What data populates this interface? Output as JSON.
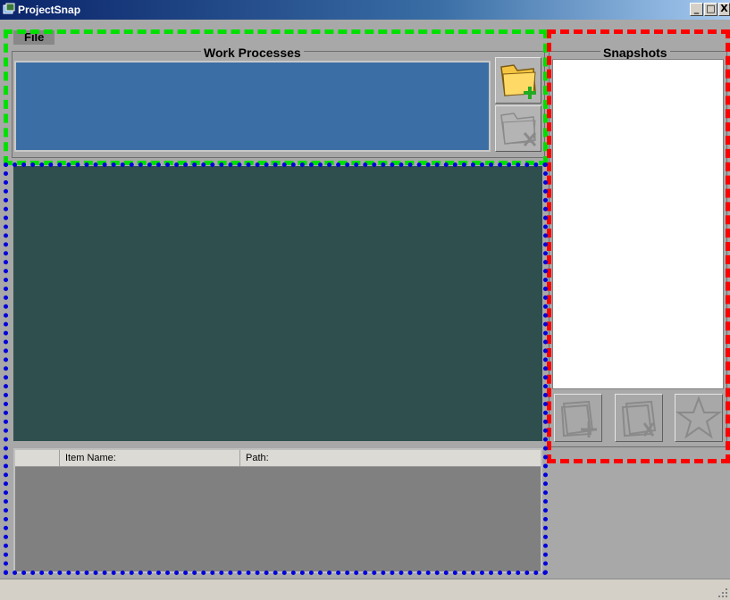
{
  "window": {
    "title": "ProjectSnap",
    "controls": {
      "minimize": "_",
      "maximize": "□",
      "close": "X"
    }
  },
  "menu": {
    "file_label": "File"
  },
  "work_processes": {
    "title": "Work Processes",
    "add_icon": "folder-add-icon",
    "remove_icon": "folder-remove-icon"
  },
  "snapshots": {
    "title": "Snapshots",
    "buttons": [
      {
        "icon": "snapshot-add-icon"
      },
      {
        "icon": "snapshot-remove-icon"
      },
      {
        "icon": "star-icon"
      }
    ]
  },
  "items_table": {
    "columns": [
      "",
      "Item Name:",
      "Path:"
    ]
  },
  "colors": {
    "work_process_list_bg": "#3b6ea5",
    "tree_panel_bg": "#2e4f4d",
    "annotation_green": "#00e000",
    "annotation_red": "#ff0000",
    "annotation_blue": "#0000dd"
  }
}
